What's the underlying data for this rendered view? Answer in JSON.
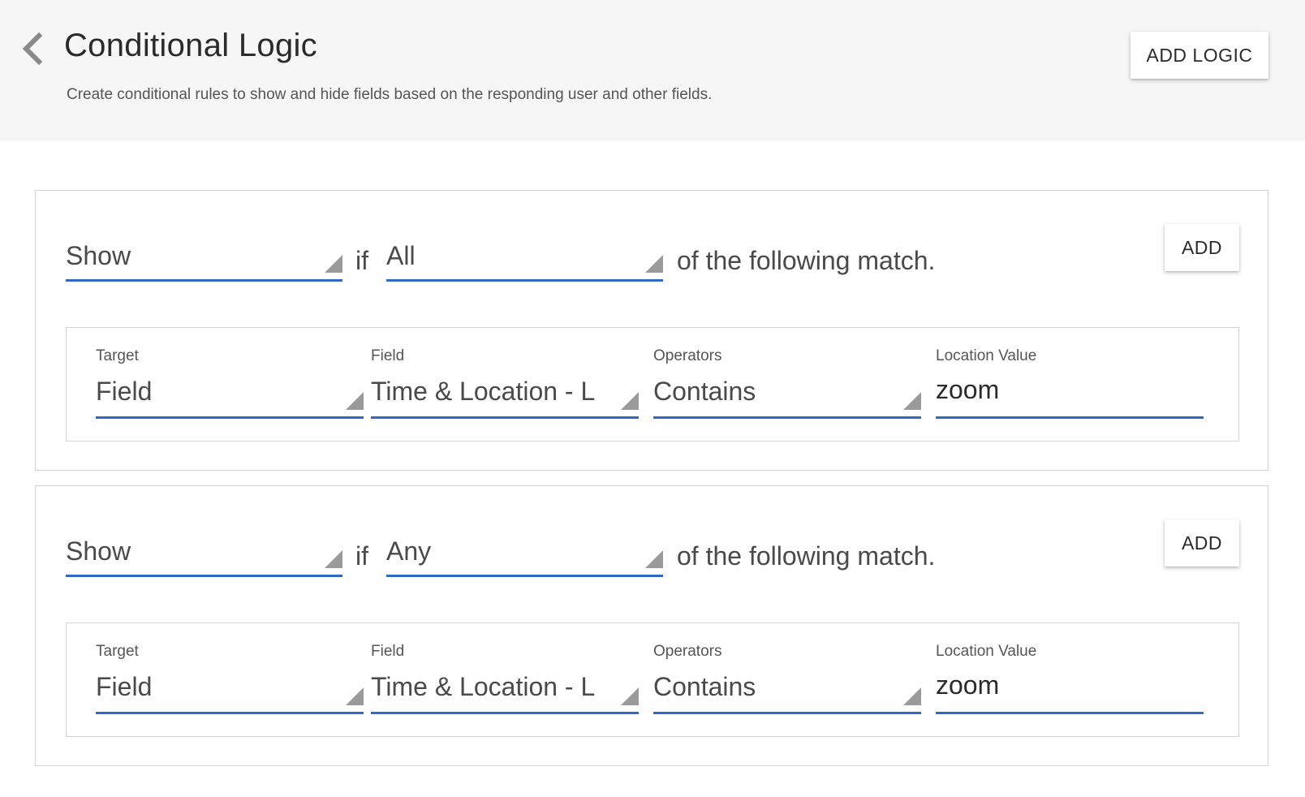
{
  "header": {
    "title": "Conditional Logic",
    "subtitle": "Create conditional rules to show and hide fields based on the responding user and other fields.",
    "add_logic_label": "ADD LOGIC"
  },
  "rules": [
    {
      "action": "Show",
      "if_word": "if",
      "match": "All",
      "following_text": "of the following match.",
      "add_label": "ADD",
      "condition": {
        "target_label": "Target",
        "target_value": "Field",
        "field_label": "Field",
        "field_value": "Time & Location - L",
        "operators_label": "Operators",
        "operators_value": "Contains",
        "value_label": "Location Value",
        "value": "zoom"
      }
    },
    {
      "action": "Show",
      "if_word": "if",
      "match": "Any",
      "following_text": "of the following match.",
      "add_label": "ADD",
      "condition": {
        "target_label": "Target",
        "target_value": "Field",
        "field_label": "Field",
        "field_value": "Time & Location - L",
        "operators_label": "Operators",
        "operators_value": "Contains",
        "value_label": "Location Value",
        "value": "zoom"
      }
    }
  ],
  "colors": {
    "accent": "#2f6bc4",
    "header_bg": "#f6f6f6",
    "border": "#d4d4d4"
  },
  "icons": {
    "back": "chevron-left-icon",
    "dropdown": "caret-corner-icon"
  }
}
